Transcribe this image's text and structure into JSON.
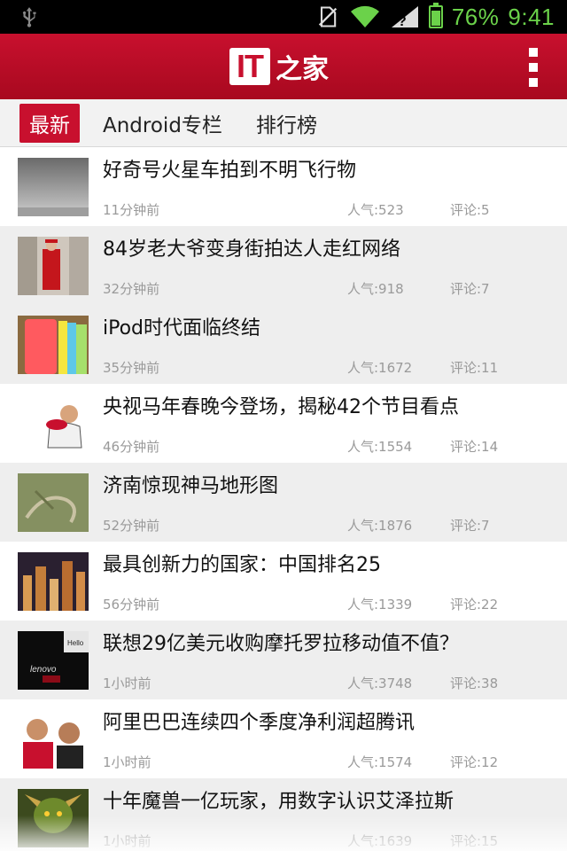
{
  "status_bar": {
    "battery": "76%",
    "time": "9:41",
    "colors": {
      "text": "#6bd24a",
      "wifi": "#6bd24a"
    }
  },
  "header": {
    "logo_box": "IT",
    "logo_text": "之家",
    "brand_color": "#c8102e"
  },
  "tabs": [
    {
      "label": "最新",
      "active": true
    },
    {
      "label": "Android专栏",
      "active": false
    },
    {
      "label": "排行榜",
      "active": false
    }
  ],
  "articles": [
    {
      "title": "好奇号火星车拍到不明飞行物",
      "time": "11分钟前",
      "views": "人气:523",
      "comments": "评论:5"
    },
    {
      "title": "84岁老大爷变身街拍达人走红网络",
      "time": "32分钟前",
      "views": "人气:918",
      "comments": "评论:7"
    },
    {
      "title": "iPod时代面临终结",
      "time": "35分钟前",
      "views": "人气:1672",
      "comments": "评论:11"
    },
    {
      "title": "央视马年春晚今登场，揭秘42个节目看点",
      "time": "46分钟前",
      "views": "人气:1554",
      "comments": "评论:14"
    },
    {
      "title": "济南惊现神马地形图",
      "time": "52分钟前",
      "views": "人气:1876",
      "comments": "评论:7"
    },
    {
      "title": "最具创新力的国家：中国排名25",
      "time": "56分钟前",
      "views": "人气:1339",
      "comments": "评论:22"
    },
    {
      "title": "联想29亿美元收购摩托罗拉移动值不值？",
      "time": "1小时前",
      "views": "人气:3748",
      "comments": "评论:38"
    },
    {
      "title": "阿里巴巴连续四个季度净利润超腾讯",
      "time": "1小时前",
      "views": "人气:1574",
      "comments": "评论:12"
    },
    {
      "title": "十年魔兽一亿玩家，用数字认识艾泽拉斯",
      "time": "1小时前",
      "views": "人气:1639",
      "comments": "评论:15"
    }
  ]
}
